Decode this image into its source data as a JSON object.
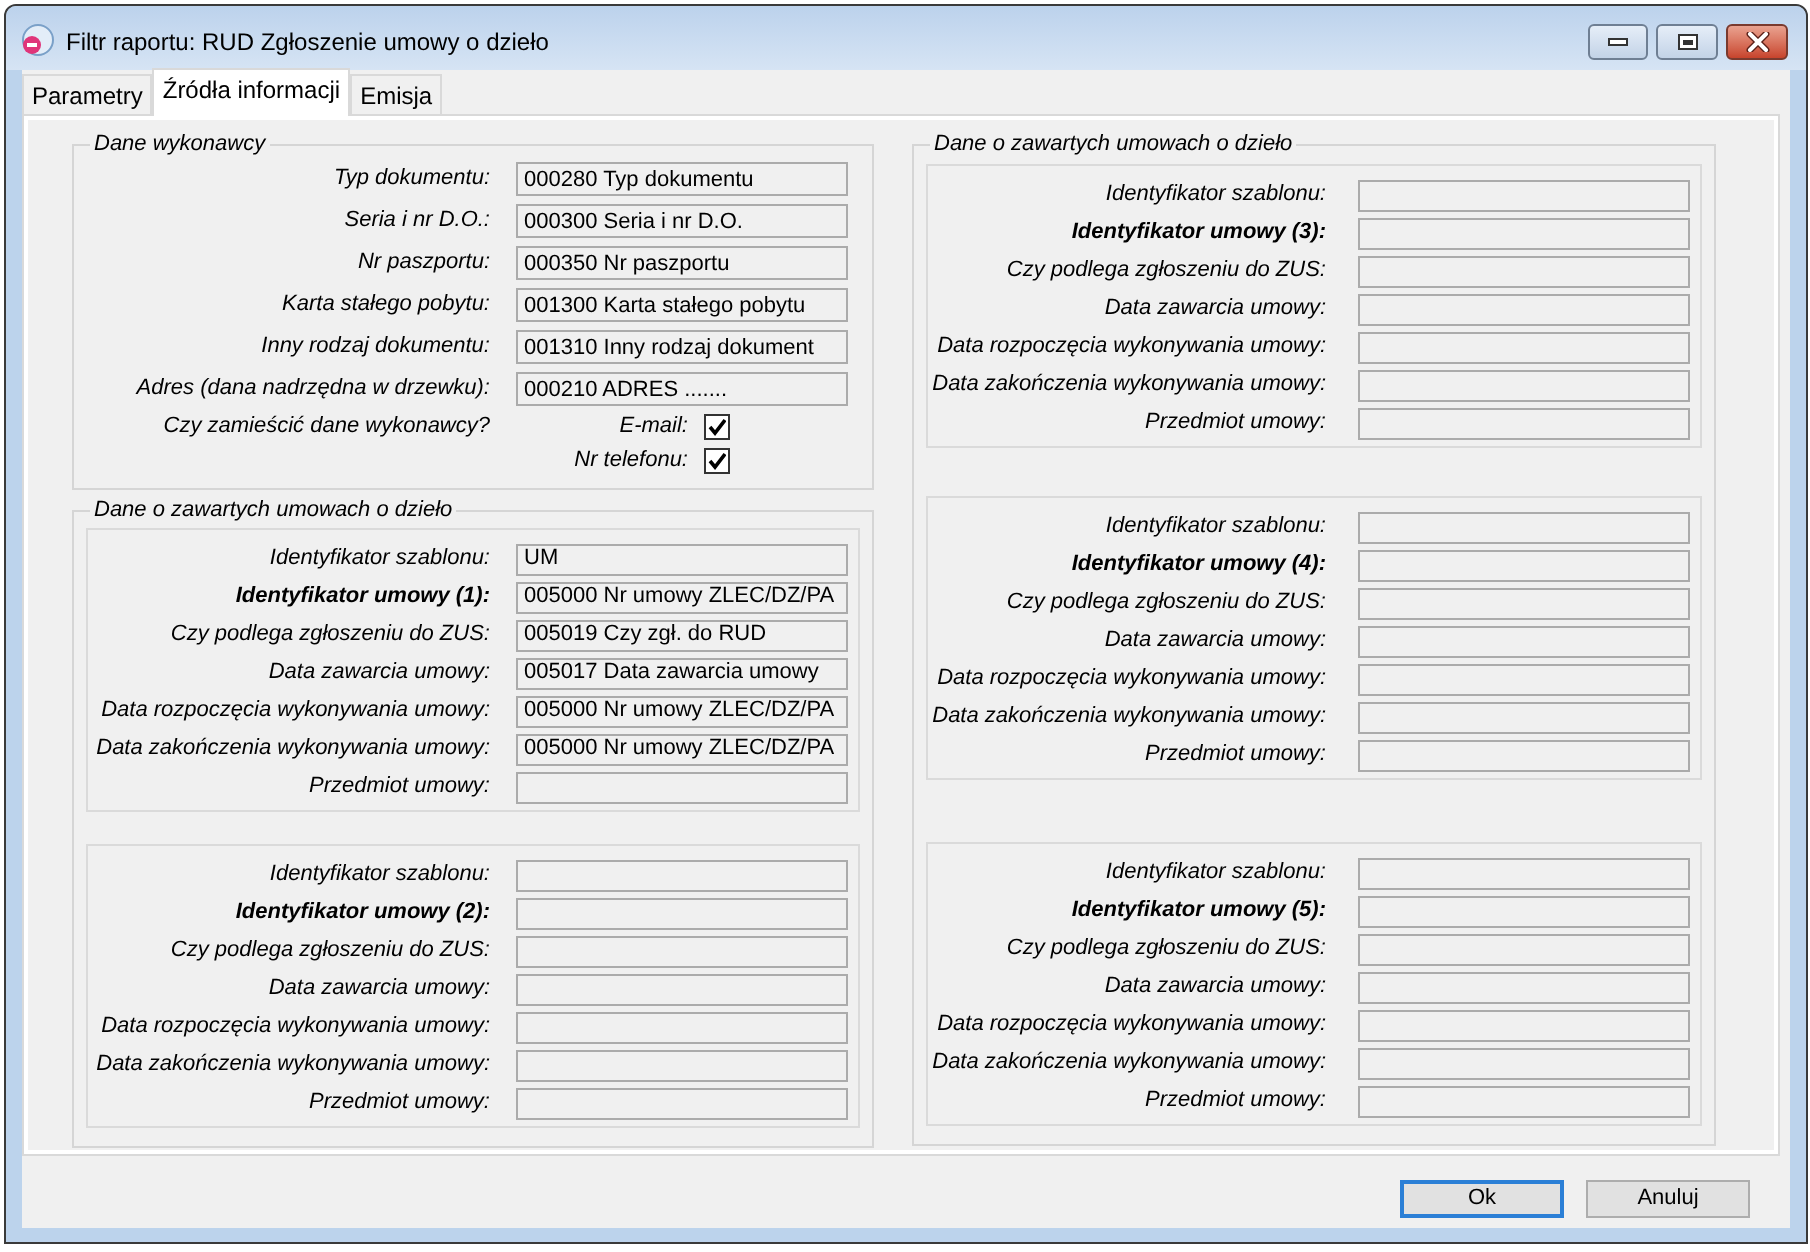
{
  "window": {
    "title": "Filtr raportu: RUD Zgłoszenie umowy o dzieło"
  },
  "tabs": [
    {
      "label": "Parametry",
      "selected": false
    },
    {
      "label": "Źródła informacji",
      "selected": true
    },
    {
      "label": "Emisja",
      "selected": false
    }
  ],
  "contractor_section": {
    "legend": "Dane wykonawcy",
    "fields": [
      {
        "label": "Typ dokumentu:",
        "value": "000280 Typ dokumentu"
      },
      {
        "label": "Seria i nr D.O.:",
        "value": "000300 Seria i nr D.O."
      },
      {
        "label": "Nr paszportu:",
        "value": "000350 Nr paszportu"
      },
      {
        "label": "Karta stałego pobytu:",
        "value": "001300 Karta stałego pobytu"
      },
      {
        "label": "Inny rodzaj dokumentu:",
        "value": "001310 Inny rodzaj dokument"
      },
      {
        "label": "Adres (dana nadrzędna w drzewku):",
        "value": "000210 ADRES ......."
      }
    ],
    "include_question": "Czy zamieścić dane wykonawcy?",
    "include_options": [
      {
        "label": "E-mail:",
        "checked": true
      },
      {
        "label": "Nr telefonu:",
        "checked": true
      }
    ]
  },
  "contract_sections": [
    {
      "legend": "Dane o zawartych umowach o dzieło",
      "groups": [
        {
          "fields": [
            {
              "label": "Identyfikator szablonu:",
              "value": "UM",
              "bold": false
            },
            {
              "label": "Identyfikator umowy (1):",
              "value": "005000 Nr umowy ZLEC/DZ/PA",
              "bold": true
            },
            {
              "label": "Czy podlega zgłoszeniu do ZUS:",
              "value": "005019 Czy zgł. do RUD",
              "bold": false
            },
            {
              "label": "Data zawarcia umowy:",
              "value": "005017 Data zawarcia umowy",
              "bold": false
            },
            {
              "label": "Data rozpoczęcia wykonywania umowy:",
              "value": "005000 Nr umowy ZLEC/DZ/PA",
              "bold": false
            },
            {
              "label": "Data zakończenia wykonywania umowy:",
              "value": "005000 Nr umowy ZLEC/DZ/PA",
              "bold": false
            },
            {
              "label": "Przedmiot umowy:",
              "bold": false
            }
          ]
        },
        {
          "fields": [
            {
              "label": "Identyfikator szablonu:",
              "bold": false
            },
            {
              "label": "Identyfikator umowy (2):",
              "bold": true
            },
            {
              "label": "Czy podlega zgłoszeniu do ZUS:",
              "bold": false
            },
            {
              "label": "Data zawarcia umowy:",
              "bold": false
            },
            {
              "label": "Data rozpoczęcia wykonywania umowy:",
              "bold": false
            },
            {
              "label": "Data zakończenia wykonywania umowy:",
              "bold": false
            },
            {
              "label": "Przedmiot umowy:",
              "bold": false
            }
          ]
        }
      ]
    },
    {
      "legend": "Dane o zawartych umowach o dzieło",
      "groups": [
        {
          "fields": [
            {
              "label": "Identyfikator szablonu:",
              "bold": false
            },
            {
              "label": "Identyfikator umowy (3):",
              "bold": true
            },
            {
              "label": "Czy podlega zgłoszeniu do ZUS:",
              "bold": false
            },
            {
              "label": "Data zawarcia umowy:",
              "bold": false
            },
            {
              "label": "Data rozpoczęcia wykonywania umowy:",
              "bold": false
            },
            {
              "label": "Data zakończenia wykonywania umowy:",
              "bold": false
            },
            {
              "label": "Przedmiot umowy:",
              "bold": false
            }
          ]
        },
        {
          "fields": [
            {
              "label": "Identyfikator szablonu:",
              "bold": false
            },
            {
              "label": "Identyfikator umowy (4):",
              "bold": true
            },
            {
              "label": "Czy podlega zgłoszeniu do ZUS:",
              "bold": false
            },
            {
              "label": "Data zawarcia umowy:",
              "bold": false
            },
            {
              "label": "Data rozpoczęcia wykonywania umowy:",
              "bold": false
            },
            {
              "label": "Data zakończenia wykonywania umowy:",
              "bold": false
            },
            {
              "label": "Przedmiot umowy:",
              "bold": false
            }
          ]
        },
        {
          "fields": [
            {
              "label": "Identyfikator szablonu:",
              "bold": false
            },
            {
              "label": "Identyfikator umowy (5):",
              "bold": true
            },
            {
              "label": "Czy podlega zgłoszeniu do ZUS:",
              "bold": false
            },
            {
              "label": "Data zawarcia umowy:",
              "bold": false
            },
            {
              "label": "Data rozpoczęcia wykonywania umowy:",
              "bold": false
            },
            {
              "label": "Data zakończenia wykonywania umowy:",
              "bold": false
            },
            {
              "label": "Przedmiot umowy:",
              "bold": false
            }
          ]
        }
      ]
    }
  ],
  "buttons": [
    {
      "label": "Ok",
      "focused": true
    },
    {
      "label": "Anuluj",
      "focused": false
    }
  ]
}
